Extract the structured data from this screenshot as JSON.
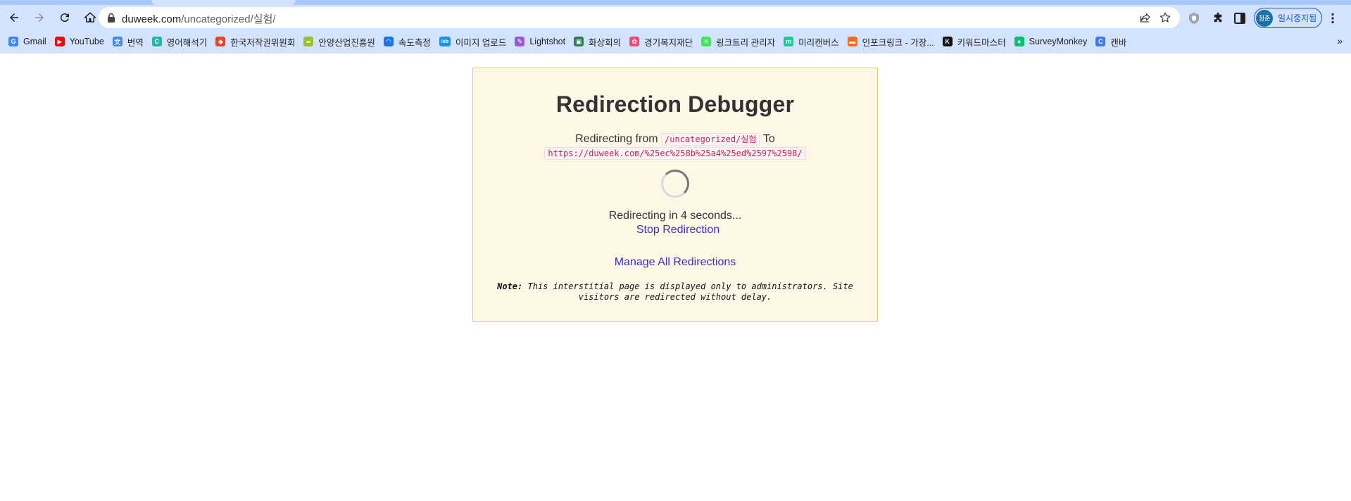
{
  "browser": {
    "url_host": "duweek.com",
    "url_path": "/uncategorized/실험/",
    "profile_label": "일시중지됨",
    "profile_avatar_text": "청춘"
  },
  "bookmarks": [
    {
      "label": "Gmail",
      "icon": "google-icon",
      "color": "#4285f4",
      "glyph": "G"
    },
    {
      "label": "YouTube",
      "icon": "youtube-icon",
      "color": "#ff0000",
      "glyph": "▶"
    },
    {
      "label": "번역",
      "icon": "translate-icon",
      "color": "#4285f4",
      "glyph": "文"
    },
    {
      "label": "영어해석기",
      "icon": "chat-icon",
      "color": "#23b5a5",
      "glyph": "C"
    },
    {
      "label": "한국저작권위원회",
      "icon": "copyright-icon",
      "color": "#e8462b",
      "glyph": "◆"
    },
    {
      "label": "안양산업진흥원",
      "icon": "anyang-icon",
      "color": "#9bbf2a",
      "glyph": "∞"
    },
    {
      "label": "속도측정",
      "icon": "speedometer-icon",
      "color": "#1a73e8",
      "glyph": "◠"
    },
    {
      "label": "이미지 업로드",
      "icon": "imgbb-icon",
      "color": "#1a8fe3",
      "glyph": "ibb"
    },
    {
      "label": "Lightshot",
      "icon": "feather-icon",
      "color": "#9b59d0",
      "glyph": "✎"
    },
    {
      "label": "화상회의",
      "icon": "meeting-icon",
      "color": "#2e7d52",
      "glyph": "▣"
    },
    {
      "label": "경기복지재단",
      "icon": "welfare-icon",
      "color": "#e94e77",
      "glyph": "✿"
    },
    {
      "label": "링크트리 관리자",
      "icon": "linktree-icon",
      "color": "#43e55e",
      "glyph": "✳"
    },
    {
      "label": "미리캔버스",
      "icon": "miricanvas-icon",
      "color": "#20c997",
      "glyph": "m"
    },
    {
      "label": "인포크링크 - 가장...",
      "icon": "inpock-icon",
      "color": "#ff6a1a",
      "glyph": "▬"
    },
    {
      "label": "키워드마스터",
      "icon": "keyword-master-icon",
      "color": "#111111",
      "glyph": "K"
    },
    {
      "label": "SurveyMonkey",
      "icon": "surveymonkey-icon",
      "color": "#00bf6f",
      "glyph": "●"
    },
    {
      "label": "캔바",
      "icon": "canva-icon",
      "color": "#3d7be8",
      "glyph": "C"
    }
  ],
  "bookmarks_overflow": "»",
  "card": {
    "title": "Redirection Debugger",
    "redirecting_from_label": "Redirecting from",
    "from_path": "/uncategorized/실험",
    "to_label": "To",
    "to_url": "https://duweek.com/%25ec%258b%25a4%25ed%2597%2598/",
    "countdown_text": "Redirecting in 4 seconds...",
    "stop_link": "Stop Redirection",
    "manage_link": "Manage All Redirections",
    "note_label": "Note:",
    "note_text": "This interstitial page is displayed only to administrators. Site visitors are redirected without delay."
  },
  "colors": {
    "card_bg": "#fff7e6",
    "card_border": "#f0c766",
    "link": "#3333cc",
    "code_text": "#c7254e",
    "chrome_bg": "#d3e3fd"
  }
}
